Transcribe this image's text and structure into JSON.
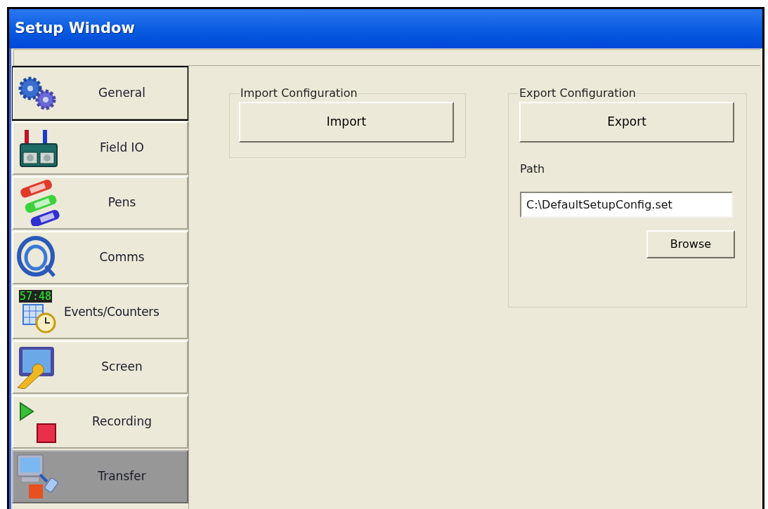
{
  "window": {
    "title": "Setup Window"
  },
  "sidebar": {
    "items": [
      {
        "label": "General",
        "kind": "gears",
        "selected": false,
        "focused": true
      },
      {
        "label": "Field IO",
        "kind": "field-io",
        "selected": false,
        "focused": false
      },
      {
        "label": "Pens",
        "kind": "pens",
        "selected": false,
        "focused": false
      },
      {
        "label": "Comms",
        "kind": "comms",
        "selected": false,
        "focused": false
      },
      {
        "label": "Events/Counters",
        "kind": "events",
        "icon_text": "57:48",
        "selected": false,
        "focused": false
      },
      {
        "label": "Screen",
        "kind": "screen",
        "selected": false,
        "focused": false
      },
      {
        "label": "Recording",
        "kind": "recording",
        "selected": false,
        "focused": false
      },
      {
        "label": "Transfer",
        "kind": "transfer",
        "selected": true,
        "focused": false
      }
    ]
  },
  "import_group": {
    "title": "Import Configuration",
    "button": "Import"
  },
  "export_group": {
    "title": "Export Configuration",
    "button": "Export",
    "path_label": "Path",
    "path_value": "C:\\DefaultSetupConfig.set",
    "browse_button": "Browse"
  }
}
